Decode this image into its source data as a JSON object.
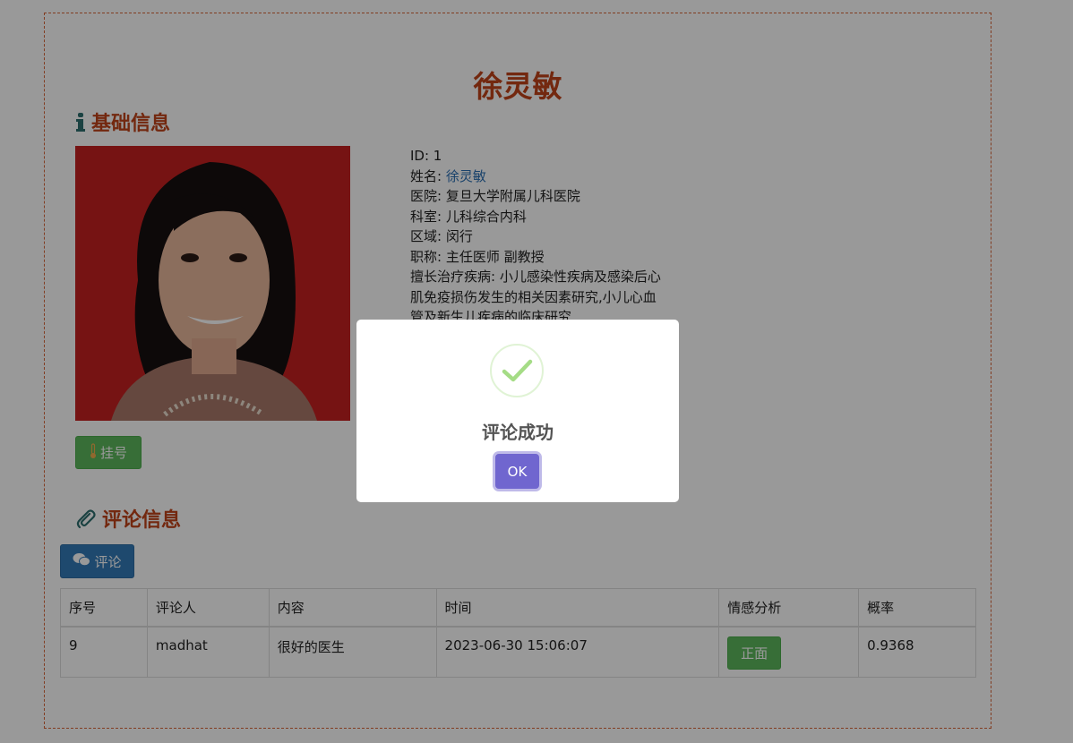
{
  "doctor": {
    "heading": "徐灵敏",
    "id_line": "ID: 1",
    "name_label": "姓名: ",
    "name_value": "徐灵敏",
    "hospital_line": "医院: 复旦大学附属儿科医院",
    "department_line": "科室: 儿科综合内科",
    "region_line": "区域: 闵行",
    "title_line": "职称: 主任医师  副教授",
    "specialty_line": "擅长治疗疾病: 小儿感染性疾病及感染后心肌免疫损伤发生的相关因素研究,小儿心血管及新生儿疾病的临床研究"
  },
  "sections": {
    "basic": {
      "title": "基础信息",
      "icon": "info-icon"
    },
    "comments": {
      "title": "评论信息",
      "icon": "paperclip-icon"
    }
  },
  "buttons": {
    "register_label": "挂号",
    "comment_label": "评论"
  },
  "table": {
    "headers": [
      "序号",
      "评论人",
      "内容",
      "时间",
      "情感分析",
      "概率"
    ],
    "rows": [
      [
        "9",
        "madhat",
        "很好的医生",
        "2023-06-30 15:06:07",
        "正面",
        "0.9368"
      ]
    ]
  },
  "modal": {
    "title": "评论成功",
    "ok_label": "OK",
    "icon": "check-icon"
  },
  "colors": {
    "accent": "#c0431a",
    "success": "#5cb85c",
    "primary": "#337ab7",
    "ok_button": "#7066cf"
  }
}
